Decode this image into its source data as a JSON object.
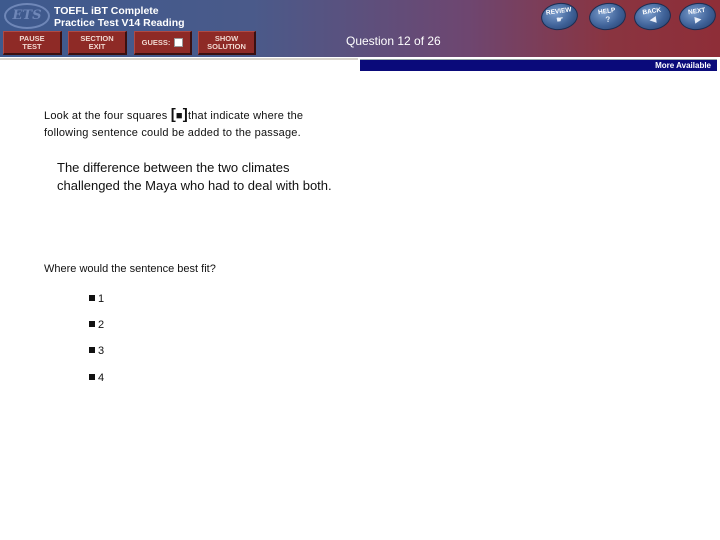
{
  "header": {
    "logo": "ETS",
    "title_line1": "TOEFL iBT Complete",
    "title_line2": "Practice Test V14 Reading",
    "question_counter": "Question 12 of 26"
  },
  "toolbar": {
    "pause_line1": "PAUSE",
    "pause_line2": "TEST",
    "section_line1": "SECTION",
    "section_line2": "EXIT",
    "guess_label": "GUESS:",
    "show_line1": "SHOW",
    "show_line2": "SOLUTION"
  },
  "nav": {
    "review": {
      "label": "REVIEW",
      "glyph": "☛"
    },
    "help": {
      "label": "HELP",
      "glyph": "?"
    },
    "back": {
      "label": "BACK",
      "glyph": "◀"
    },
    "next": {
      "label": "NEXT",
      "glyph": "▶"
    }
  },
  "more_available": "More Available",
  "question": {
    "instruction_pre": "Look at the four squares ",
    "instruction_open": "[",
    "instruction_square": "■",
    "instruction_close": "]",
    "instruction_post": "that indicate where the following sentence could be added to the passage.",
    "sentence": "The difference between the two climates challenged the Maya who had to deal with both.",
    "prompt": "Where would the sentence best fit?",
    "options": [
      "1",
      "2",
      "3",
      "4"
    ]
  },
  "colors": {
    "more_bar": "#0a0a7a",
    "toolbar_button": "#8e2a26"
  }
}
